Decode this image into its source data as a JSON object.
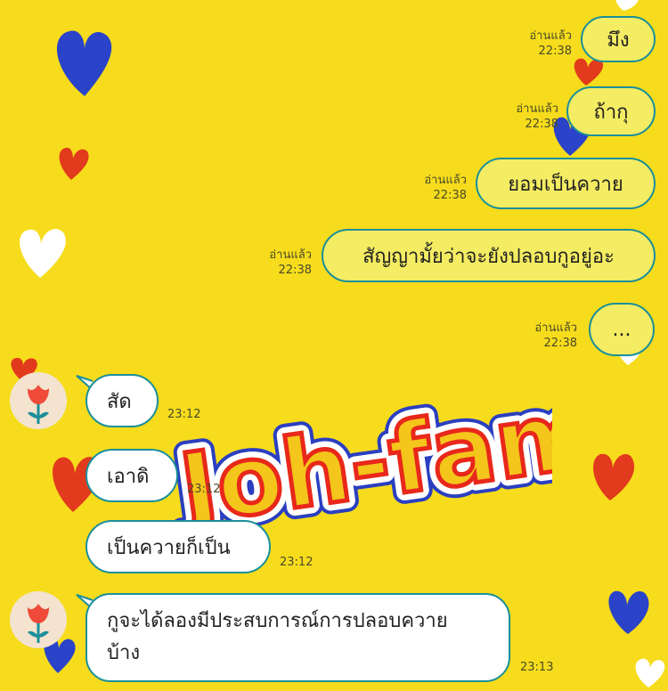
{
  "theme": {
    "background": "#f6dc1c",
    "bubble_border": "#1a8f9a",
    "outgoing_fill": "#f4ec62",
    "incoming_fill": "#ffffff"
  },
  "sticker": {
    "text": "Joh-fam"
  },
  "outgoing": [
    {
      "text": "มึง",
      "read": "อ่านแล้ว",
      "time": "22:38"
    },
    {
      "text": "ถ้ากุ",
      "read": "อ่านแล้ว",
      "time": "22:38"
    },
    {
      "text": "ยอมเป็นควาย",
      "read": "อ่านแล้ว",
      "time": "22:38"
    },
    {
      "text": "สัญญามั้ยว่าจะยังปลอบกูอยู่อะ",
      "read": "อ่านแล้ว",
      "time": "22:38"
    },
    {
      "text": "...",
      "read": "อ่านแล้ว",
      "time": "22:38"
    }
  ],
  "incoming": [
    {
      "text": "สัด",
      "time": "23:12"
    },
    {
      "text": "เอาดิ",
      "time": "23:12"
    },
    {
      "text": "เป็นควายก็เป็น",
      "time": "23:12"
    },
    {
      "line1": "กูจะได้ลองมีประสบการณ์การปลอบควาย",
      "line2": "บ้าง",
      "time": "23:13"
    }
  ],
  "avatar_icon": "red-tulip-icon"
}
